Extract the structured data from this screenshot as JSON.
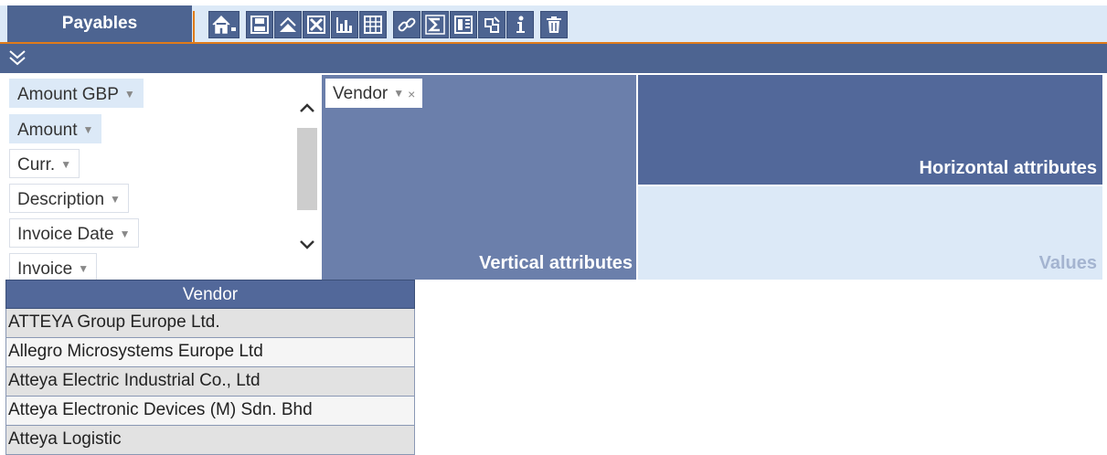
{
  "header": {
    "active_tab": "Payables"
  },
  "toolbar": {
    "icons": [
      "home-icon",
      "save-icon",
      "export-icon",
      "excel-icon",
      "chart-icon",
      "grid-icon",
      "link-icon",
      "sum-icon",
      "columns-icon",
      "settings-icon",
      "info-icon",
      "delete-icon"
    ]
  },
  "attributes": {
    "items": [
      {
        "label": "Amount GBP",
        "selected": true
      },
      {
        "label": "Amount",
        "selected": true
      },
      {
        "label": "Curr.",
        "selected": false
      },
      {
        "label": "Description",
        "selected": false
      },
      {
        "label": "Invoice Date",
        "selected": false
      },
      {
        "label": "Invoice",
        "selected": false
      }
    ]
  },
  "zones": {
    "vertical": {
      "label": "Vertical attributes",
      "chip": "Vendor"
    },
    "horizontal": {
      "label": "Horizontal attributes"
    },
    "values": {
      "label": "Values"
    }
  },
  "table": {
    "header": "Vendor",
    "rows": [
      "ATTEYA Group Europe Ltd.",
      "Allegro Microsystems Europe Ltd",
      "Atteya Electric Industrial Co., Ltd",
      "Atteya Electronic Devices (M) Sdn. Bhd",
      "Atteya Logistic"
    ]
  },
  "colors": {
    "header_blue": "#4d6491",
    "accent_orange": "#e07b1a",
    "light_blue": "#dce9f7"
  }
}
